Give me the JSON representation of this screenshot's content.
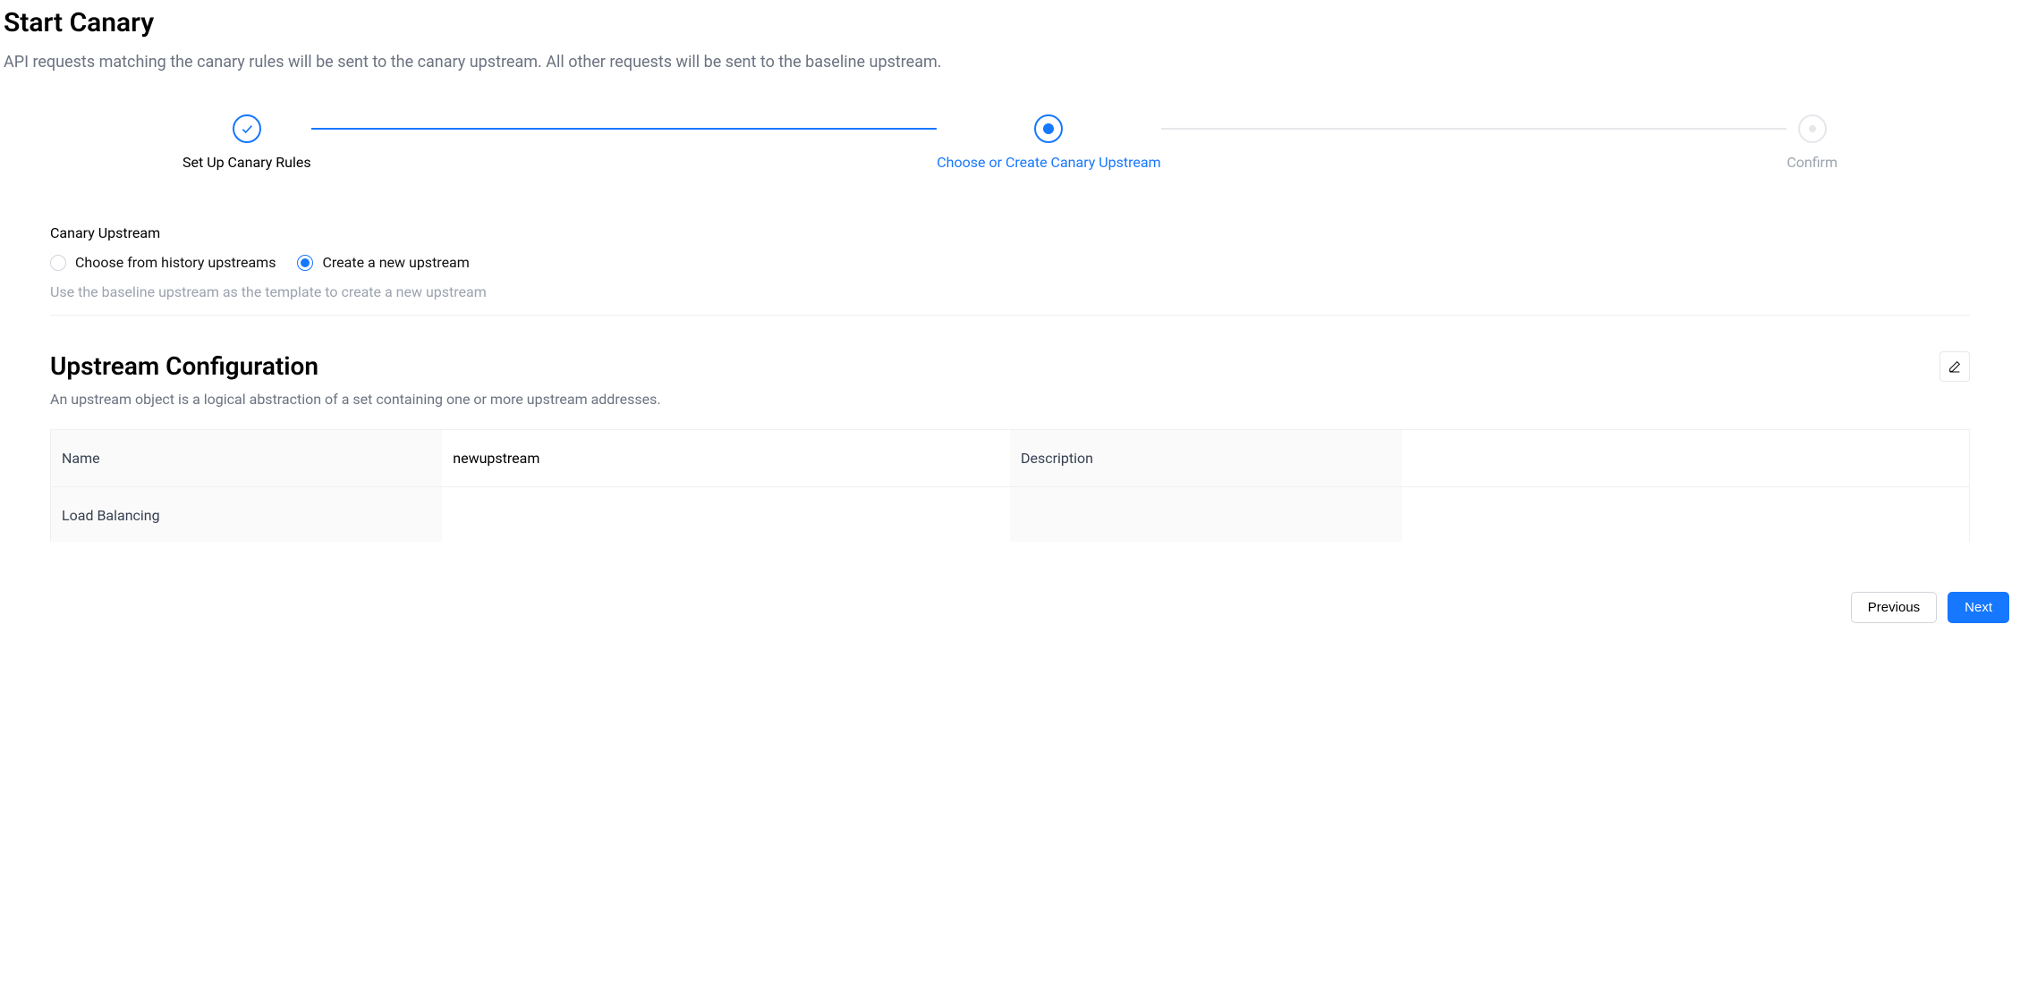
{
  "header": {
    "title": "Start Canary",
    "subtitle": "API requests matching the canary rules will be sent to the canary upstream. All other requests will be sent to the baseline upstream."
  },
  "stepper": {
    "steps": [
      {
        "label": "Set Up Canary Rules",
        "status": "done"
      },
      {
        "label": "Choose or Create Canary Upstream",
        "status": "active"
      },
      {
        "label": "Confirm",
        "status": "pending"
      }
    ]
  },
  "canary_upstream": {
    "section_label": "Canary Upstream",
    "options": [
      {
        "label": "Choose from history upstreams",
        "checked": false
      },
      {
        "label": "Create a new upstream",
        "checked": true
      }
    ],
    "help_text": "Use the baseline upstream as the template to create a new upstream"
  },
  "upstream_config": {
    "title": "Upstream Configuration",
    "description": "An upstream object is a logical abstraction of a set containing one or more upstream addresses.",
    "rows": [
      {
        "label1": "Name",
        "value1": "newupstream",
        "label2": "Description",
        "value2": ""
      },
      {
        "label1": "Load Balancing",
        "value1": "",
        "label2": "",
        "value2": ""
      }
    ]
  },
  "footer": {
    "previous": "Previous",
    "next": "Next"
  }
}
